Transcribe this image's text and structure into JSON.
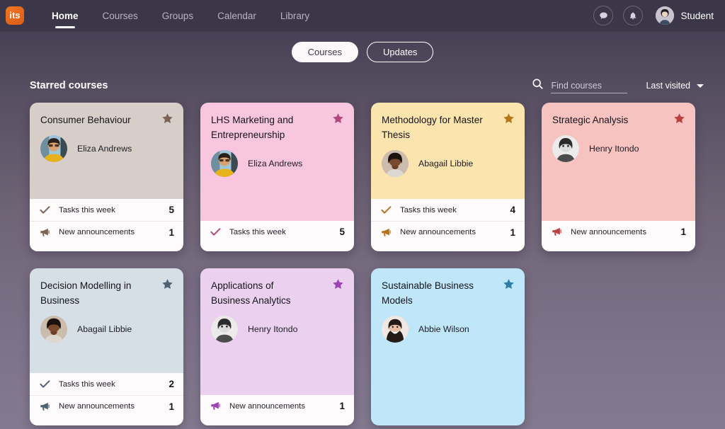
{
  "app": {
    "logo_text": "its",
    "logo_color": "#e8681f"
  },
  "topnav": {
    "items": [
      {
        "label": "Home",
        "active": true
      },
      {
        "label": "Courses",
        "active": false
      },
      {
        "label": "Groups",
        "active": false
      },
      {
        "label": "Calendar",
        "active": false
      },
      {
        "label": "Library",
        "active": false
      }
    ],
    "messages_icon": "chat-bubble-icon",
    "notifications_icon": "bell-icon",
    "user_label": "Student"
  },
  "segmented": {
    "options": [
      {
        "label": "Courses",
        "selected": true
      },
      {
        "label": "Updates",
        "selected": false
      }
    ]
  },
  "section": {
    "title": "Starred courses",
    "search": {
      "icon": "search-icon",
      "placeholder": "Find courses",
      "value": ""
    },
    "sort": {
      "label": "Last visited",
      "icon": "chevron-down-icon"
    }
  },
  "cards": [
    {
      "title": "Consumer Behaviour",
      "teacher": "Eliza Andrews",
      "bg": "#d8cec9",
      "accent": "#7b6457",
      "starred": true,
      "row": 1,
      "stats": [
        {
          "icon": "check-icon",
          "label": "Tasks this week",
          "count": "5"
        },
        {
          "icon": "megaphone-icon",
          "label": "New announcements",
          "count": "1"
        }
      ]
    },
    {
      "title": "LHS Marketing and Entrepreneurship",
      "teacher": "Eliza Andrews",
      "bg": "#f8c6de",
      "accent": "#b04a7e",
      "starred": true,
      "row": 1,
      "stats": [
        {
          "icon": "check-icon",
          "label": "Tasks this week",
          "count": "5"
        }
      ]
    },
    {
      "title": "Methodology for Master Thesis",
      "teacher": "Abagail Libbie",
      "bg": "#fbe4ae",
      "accent": "#b4761c",
      "starred": true,
      "row": 1,
      "stats": [
        {
          "icon": "check-icon",
          "label": "Tasks this week",
          "count": "4"
        },
        {
          "icon": "megaphone-icon",
          "label": "New announcements",
          "count": "1"
        }
      ]
    },
    {
      "title": "Strategic Analysis",
      "teacher": "Henry Itondo",
      "bg": "#f6c3c0",
      "accent": "#bc3f44",
      "starred": true,
      "row": 1,
      "stats": [
        {
          "icon": "megaphone-icon",
          "label": "New announcements",
          "count": "1"
        }
      ]
    },
    {
      "title": "Decision Modelling in Business",
      "teacher": "Abagail Libbie",
      "bg": "#d6dfe5",
      "accent": "#4e6473",
      "starred": true,
      "row": 2,
      "stats": [
        {
          "icon": "check-icon",
          "label": "Tasks this week",
          "count": "2"
        },
        {
          "icon": "megaphone-icon",
          "label": "New announcements",
          "count": "1"
        }
      ]
    },
    {
      "title": "Applications of Business Analytics",
      "teacher": "Henry Itondo",
      "bg": "#ecd0ef",
      "accent": "#9b45b5",
      "starred": true,
      "row": 2,
      "stats": [
        {
          "icon": "megaphone-icon",
          "label": "New announcements",
          "count": "1"
        }
      ]
    },
    {
      "title": "Sustainable Business Models",
      "teacher": "Abbie Wilson",
      "bg": "#bfe6f9",
      "accent": "#2c7fa8",
      "starred": true,
      "row": 2,
      "stats": []
    }
  ]
}
